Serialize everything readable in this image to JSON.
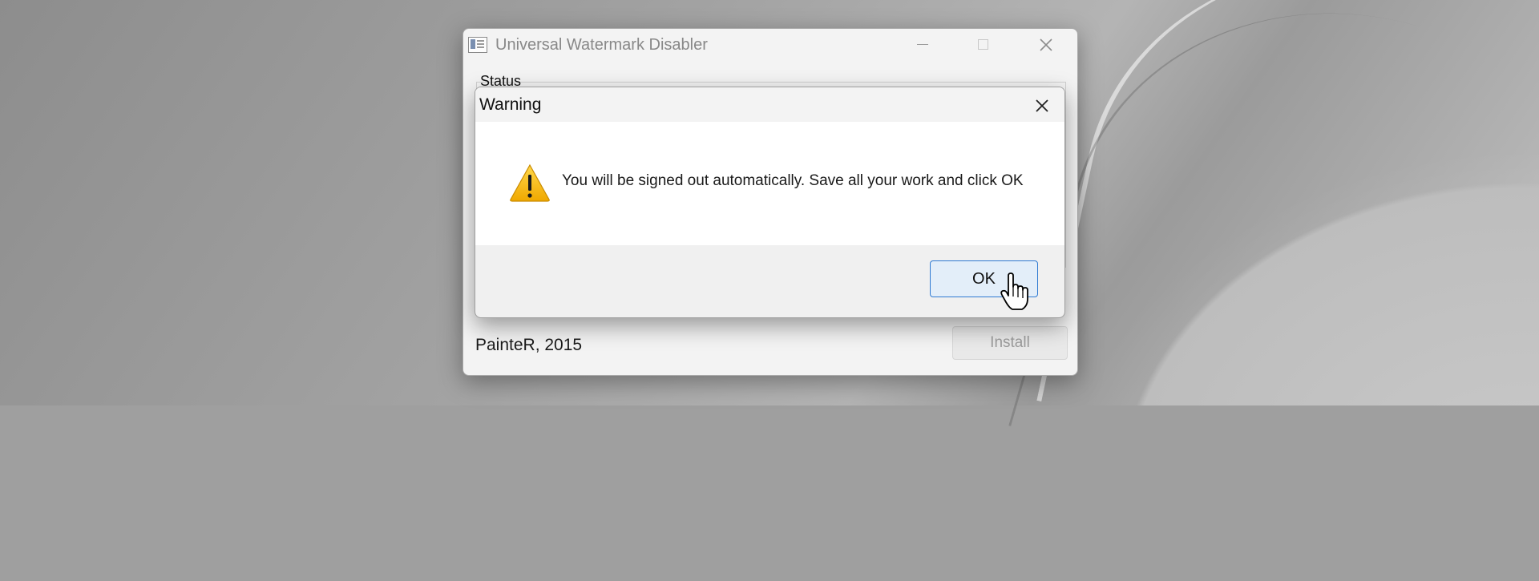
{
  "app_window": {
    "title": "Universal Watermark Disabler",
    "status_label": "Status",
    "credit": "PainteR, 2015",
    "install_label": "Install"
  },
  "dialog": {
    "title": "Warning",
    "message": "You will be signed out automatically. Save all your work and click OK",
    "ok_label": "OK",
    "icon": "warning-icon"
  },
  "colors": {
    "accent": "#2f7ad2",
    "warning_fill": "#f7c21a"
  }
}
